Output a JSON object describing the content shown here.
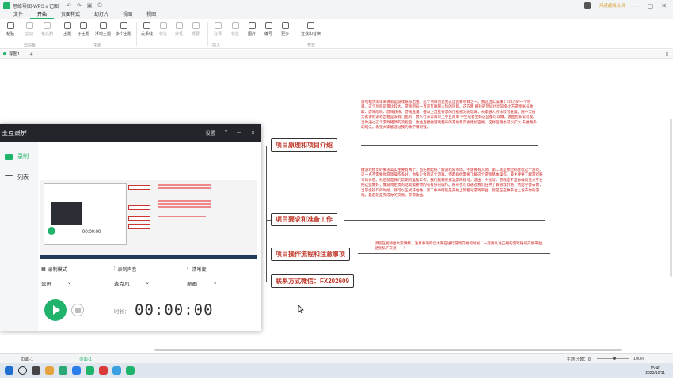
{
  "titlebar": {
    "title": "思维导图-WPS x 记图",
    "vip_text": "开通超级会员",
    "min": "—",
    "max": "▢",
    "close": "✕"
  },
  "menu": [
    "文件",
    "开始",
    "页面样式",
    "幻灯片",
    "视图",
    "视图"
  ],
  "ribbon": {
    "buttons": [
      {
        "label": "粘贴"
      },
      {
        "label": "剪切"
      },
      {
        "label": "格式刷"
      },
      {
        "label": "主题"
      },
      {
        "label": "子主题"
      },
      {
        "label": "浮动主题"
      },
      {
        "label": "多个主题"
      },
      {
        "label": "关系线"
      },
      {
        "label": "标注"
      },
      {
        "label": "外框"
      },
      {
        "label": "概要"
      },
      {
        "label": "注释"
      },
      {
        "label": "标签"
      },
      {
        "label": "图片"
      },
      {
        "label": "编号"
      },
      {
        "label": "更多"
      },
      {
        "label": "查找和替换"
      }
    ],
    "groups": [
      "剪贴板",
      "主题",
      "插入",
      "查找"
    ]
  },
  "tabbar": {
    "tab": "导图1",
    "plus": "+"
  },
  "mindmap": {
    "nodes": [
      {
        "text": "项目原理和项目介绍"
      },
      {
        "text": "项目要求和准备工作"
      },
      {
        "text": "项目操作流程和注意事项"
      },
      {
        "text": "联系方式微信：FX202609"
      }
    ],
    "notes": [
      "游戏租赁简单来讲就是游戏账号出租。这个项目也是我这边首要项目之一。我这边实操赚了126万的一个项目。这个项目前景比较大，游戏租号一直是互联网火热的项目。这方面 赚钱的区域也比较多比方游戏账号收取、游戏陪玩、游戏装修、游戏直播。但以上这些要求的门槛相对比较高，大家想入行比较有难度。而今天给大家讲的游戏出租是没有门槛的，想入行非常简单上手且简单 学生或者宝妈这些都可以做。收益也非常可观。当你通过这个游戏租赁的流程后，收益直接做游戏租号的其他老实会更加容易，这样后期也可以扩大 去做更多的玩法。希望大家能通过我的教学赚到钱。",
      "做游戏租赁的要求其实主要有两个。首先你起码了解游戏的市场。不需要有入场、第二就是你起码会玩这个游戏。这一点不需要你游戏操作多好。你多少会玩这个游戏，但起码你需要了解这个游戏基本操作，最主要要了解游戏账号的价值。然后就是我们前期的准备工作，我们就需要挑选游戏账号，选出一个账号，游戏是不是你做的重点平台把这些做好，做游戏租赁的话就需要你的号有好的操作。账号也可以通过我们在中了解游戏价格，然后学会去做，当学会操作的时候，就可以正式开始做，第二件事情就是开始上架租号游戏平台。就是在这种平台上发布你的游戏，最后就是完成你的交易，获得收益。",
      "流程在视频给大家讲解，注意事项的话大家在进行游戏交易的时候，一定要认准正规的游戏账号交易平台，避免私下交易！！！"
    ]
  },
  "recorder": {
    "name": "土豆录屏",
    "settings_label": "设置",
    "side": [
      {
        "label": "录制"
      },
      {
        "label": "列表"
      }
    ],
    "preview_time": "00:00:00",
    "options": [
      {
        "label": "录制模式",
        "value": "全屏"
      },
      {
        "label": "录制声音",
        "value": "麦克风"
      },
      {
        "label": "清晰度",
        "value": "原画"
      }
    ],
    "time_label": "时长：",
    "timer": "00:00:00"
  },
  "statusbar": {
    "page": "页面-1",
    "page2": "页面-1",
    "topics": "主题计数：8",
    "zoom": "100%"
  },
  "clock": {
    "time": "15:40",
    "date": "2023/10/11"
  },
  "colors": {
    "accent": "#1fb36b",
    "node_text": "#c0392b",
    "note_text": "#d02020",
    "recorder_head": "#23252b"
  }
}
